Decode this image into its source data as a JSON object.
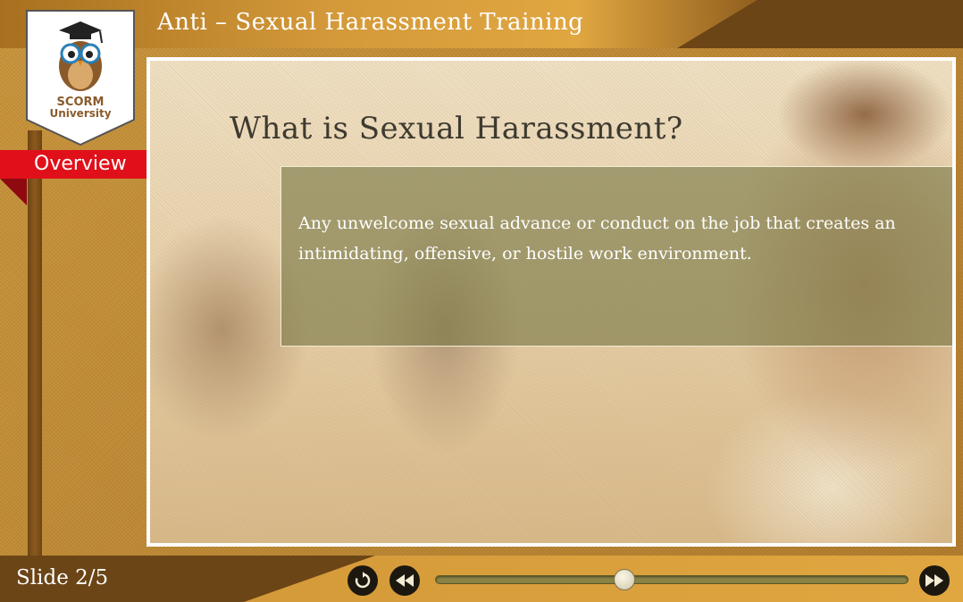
{
  "course": {
    "title": "Anti – Sexual Harassment Training"
  },
  "logo": {
    "line1": "SCORM",
    "line2": "University"
  },
  "section": {
    "label": "Overview"
  },
  "slide": {
    "title": "What is Sexual Harassment?",
    "definition": "Any unwelcome sexual advance or conduct on the job that creates an intimidating, offensive, or hostile work environment."
  },
  "player": {
    "counter": "Slide 2/5",
    "progress": 0.4,
    "buttons": {
      "replay": "replay-icon",
      "back": "rewind-icon",
      "next": "fast-forward-icon"
    }
  },
  "colors": {
    "accent": "#d49a3a",
    "dark": "#6b4516",
    "ribbon": "#e0101a"
  }
}
